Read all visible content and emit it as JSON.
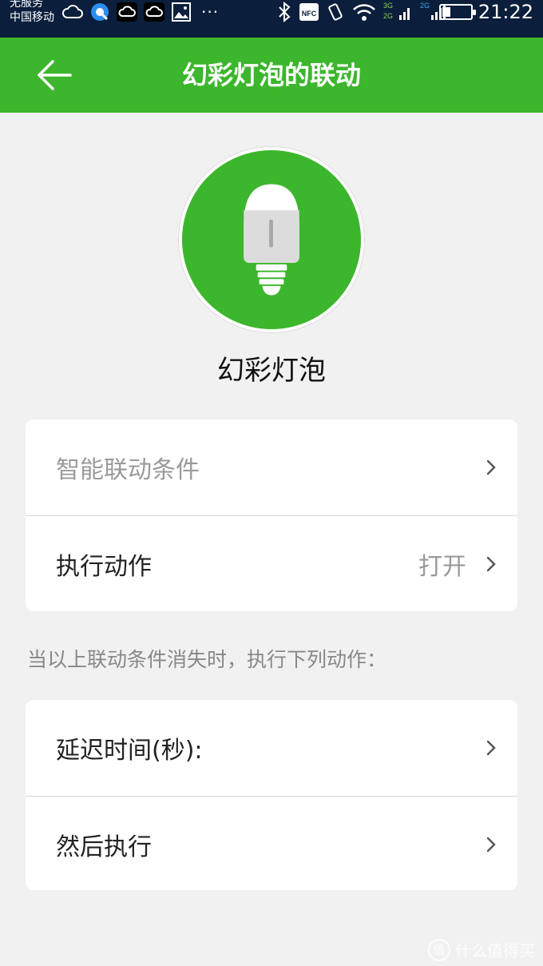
{
  "status_bar": {
    "carrier_line1": "无服务",
    "carrier_line2": "中国移动",
    "more": "···",
    "nfc": "NFC",
    "net1": "3G",
    "net2": "2G",
    "net3": "2G",
    "time": "21:22",
    "battery_level": 0.3
  },
  "app_bar": {
    "title": "幻彩灯泡的联动",
    "back_icon": "arrow-left-icon"
  },
  "device": {
    "name": "幻彩灯泡",
    "icon": "light-bulb-icon",
    "accent_color": "#3cb62c"
  },
  "card1": {
    "row1_label": "智能联动条件",
    "row2_label": "执行动作",
    "row2_value": "打开"
  },
  "hint": "当以上联动条件消失时，执行下列动作：",
  "card2": {
    "row1_label": "延迟时间(秒):",
    "row2_label": "然后执行"
  },
  "watermark": {
    "logo": "值",
    "text": "什么值得买"
  }
}
